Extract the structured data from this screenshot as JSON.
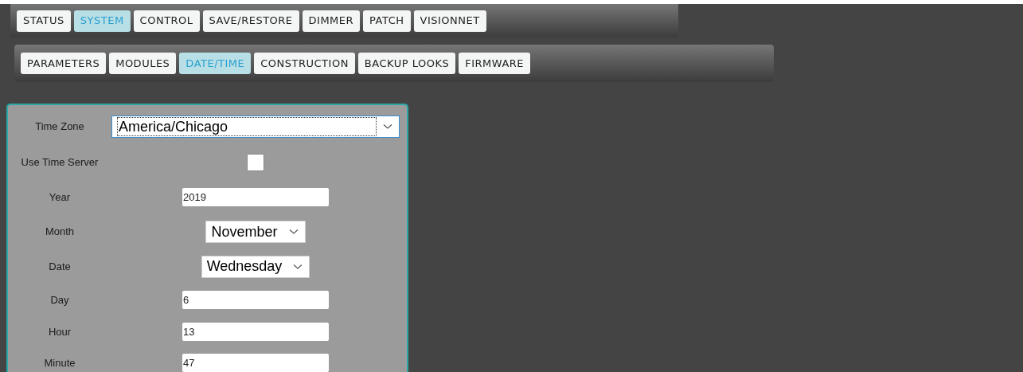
{
  "main_tabs": [
    {
      "label": "STATUS",
      "selected": false
    },
    {
      "label": "SYSTEM",
      "selected": true
    },
    {
      "label": "CONTROL",
      "selected": false
    },
    {
      "label": "SAVE/RESTORE",
      "selected": false
    },
    {
      "label": "DIMMER",
      "selected": false
    },
    {
      "label": "PATCH",
      "selected": false
    },
    {
      "label": "VISIONNET",
      "selected": false
    }
  ],
  "sub_tabs": [
    {
      "label": "PARAMETERS",
      "selected": false
    },
    {
      "label": "MODULES",
      "selected": false
    },
    {
      "label": "DATE/TIME",
      "selected": true
    },
    {
      "label": "CONSTRUCTION",
      "selected": false
    },
    {
      "label": "BACKUP LOOKS",
      "selected": false
    },
    {
      "label": "FIRMWARE",
      "selected": false
    }
  ],
  "form": [
    {
      "kind": "wide_select",
      "label": "Time Zone",
      "value": "America/Chicago"
    },
    {
      "kind": "checkbox",
      "label": "Use Time Server",
      "checked": false
    },
    {
      "kind": "text",
      "label": "Year",
      "value": "2019"
    },
    {
      "kind": "select",
      "label": "Month",
      "value": "November"
    },
    {
      "kind": "select",
      "label": "Date",
      "value": "Wednesday"
    },
    {
      "kind": "text",
      "label": "Day",
      "value": "6"
    },
    {
      "kind": "text",
      "label": "Hour",
      "value": "13"
    },
    {
      "kind": "text",
      "label": "Minute",
      "value": "47"
    }
  ]
}
